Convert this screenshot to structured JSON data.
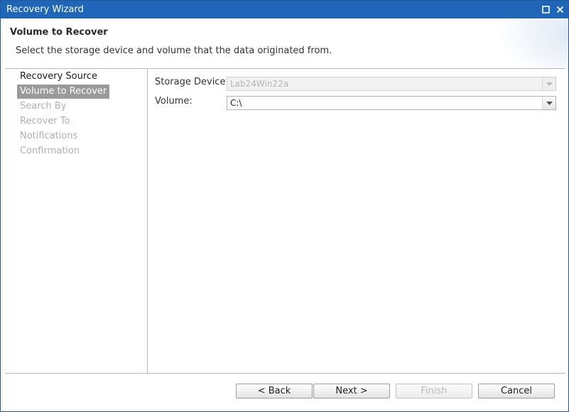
{
  "window": {
    "title": "Recovery Wizard",
    "maximize_icon": "maximize-icon",
    "close_icon": "close-icon"
  },
  "header": {
    "title": "Volume to Recover",
    "description": "Select the storage device and volume that the data originated from."
  },
  "nav": {
    "items": [
      {
        "label": "Recovery Source",
        "state": "done"
      },
      {
        "label": "Volume to Recover",
        "state": "active"
      },
      {
        "label": "Search By",
        "state": "disabled"
      },
      {
        "label": "Recover To",
        "state": "disabled"
      },
      {
        "label": "Notifications",
        "state": "disabled"
      },
      {
        "label": "Confirmation",
        "state": "disabled"
      }
    ]
  },
  "form": {
    "storage_device": {
      "label": "Storage Device:",
      "value": "Lab24Win22a",
      "enabled": false
    },
    "volume": {
      "label": "Volume:",
      "value": "C:\\",
      "enabled": true
    }
  },
  "buttons": {
    "back": "< Back",
    "next": "Next >",
    "finish": "Finish",
    "cancel": "Cancel"
  },
  "colors": {
    "titlebar": "#1f66b8",
    "active_nav": "#9a9a9a",
    "disabled_text": "#b0b0b0"
  }
}
